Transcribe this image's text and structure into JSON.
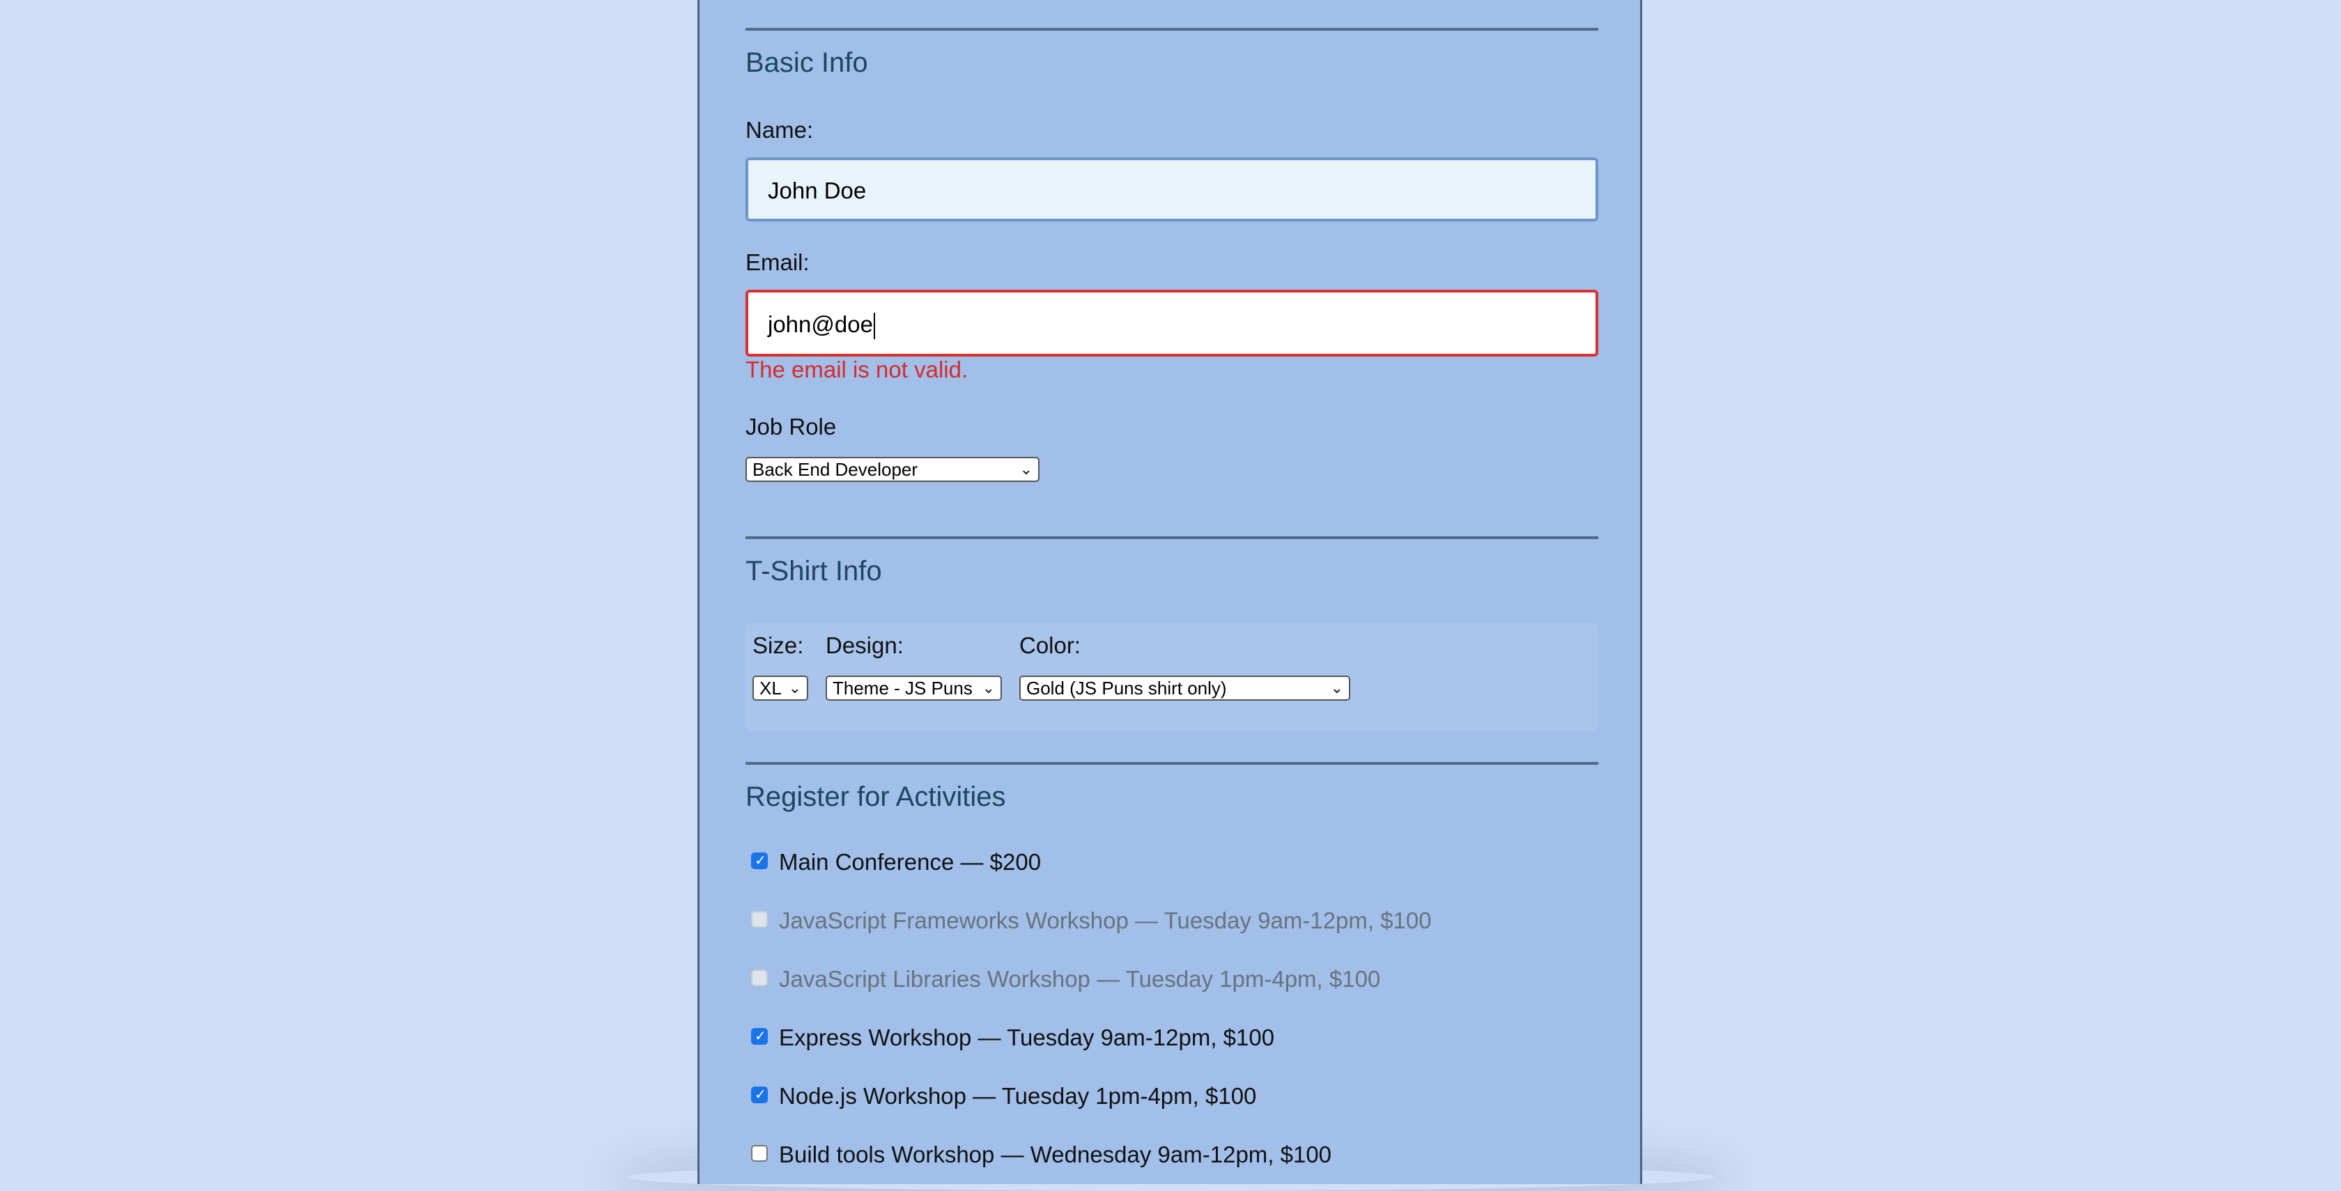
{
  "basic_info": {
    "legend": "Basic Info",
    "name_label": "Name:",
    "name_value": "John Doe",
    "email_label": "Email:",
    "email_value": "john@doe",
    "email_error": "The email is not valid.",
    "job_role_label": "Job Role",
    "job_role_selected": "Back End Developer"
  },
  "tshirt": {
    "legend": "T-Shirt Info",
    "size_label": "Size:",
    "size_selected": "XL",
    "design_label": "Design:",
    "design_selected": "Theme - JS Puns",
    "color_label": "Color:",
    "color_selected": "Gold (JS Puns shirt only)"
  },
  "activities": {
    "legend": "Register for Activities",
    "items": [
      {
        "label": "Main Conference — $200",
        "checked": true,
        "disabled": false
      },
      {
        "label": "JavaScript Frameworks Workshop — Tuesday 9am-12pm, $100",
        "checked": false,
        "disabled": true
      },
      {
        "label": "JavaScript Libraries Workshop — Tuesday 1pm-4pm, $100",
        "checked": false,
        "disabled": true
      },
      {
        "label": "Express Workshop — Tuesday 9am-12pm, $100",
        "checked": true,
        "disabled": false
      },
      {
        "label": "Node.js Workshop — Tuesday 1pm-4pm, $100",
        "checked": true,
        "disabled": false
      },
      {
        "label": "Build tools Workshop — Wednesday 9am-12pm, $100",
        "checked": false,
        "disabled": false
      }
    ]
  },
  "colors": {
    "page_background": "#d0dff7",
    "form_background": "#a1bfe9",
    "legend_text": "#1e4566",
    "error": "#d92a2a",
    "checkbox_checked": "#1a73e8"
  },
  "icons": {
    "select_chevron": "chevron-down-icon",
    "checkbox_check": "check-icon"
  }
}
